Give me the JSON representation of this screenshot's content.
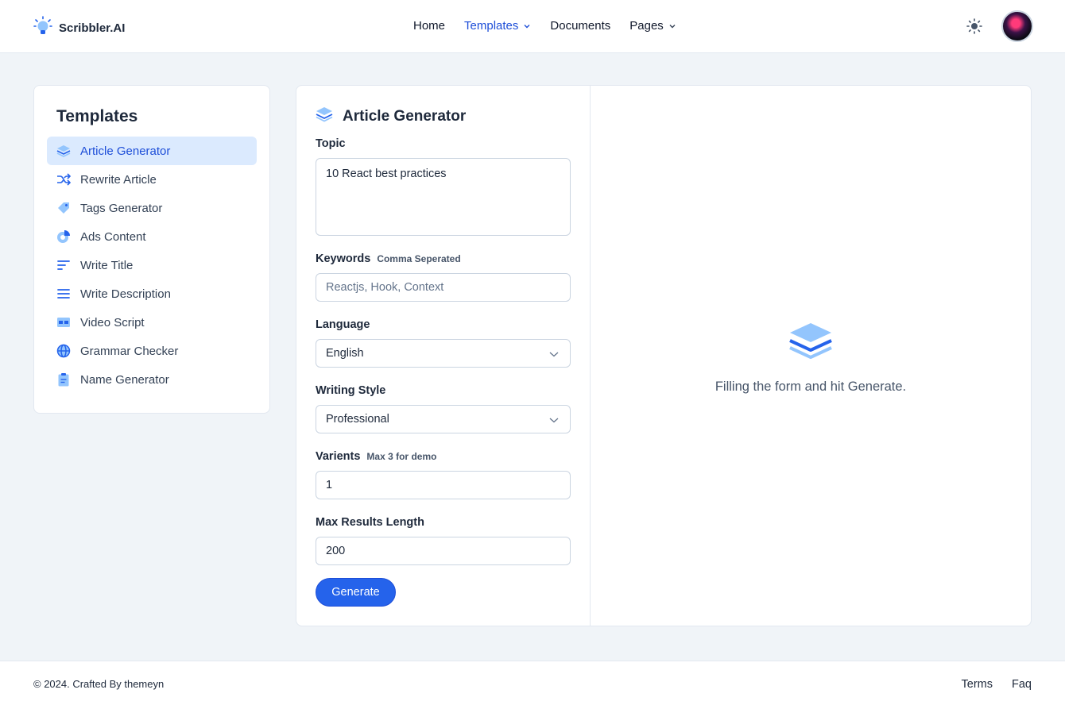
{
  "header": {
    "brand": "Scribbler.AI",
    "nav": [
      {
        "label": "Home"
      },
      {
        "label": "Templates"
      },
      {
        "label": "Documents"
      },
      {
        "label": "Pages"
      }
    ]
  },
  "sidebar": {
    "title": "Templates",
    "items": [
      {
        "label": "Article Generator",
        "icon": "layers-icon"
      },
      {
        "label": "Rewrite Article",
        "icon": "shuffle-icon"
      },
      {
        "label": "Tags Generator",
        "icon": "tag-icon"
      },
      {
        "label": "Ads Content",
        "icon": "pie-chart-icon"
      },
      {
        "label": "Write Title",
        "icon": "align-left-icon"
      },
      {
        "label": "Write Description",
        "icon": "menu-lines-icon"
      },
      {
        "label": "Video Script",
        "icon": "film-icon"
      },
      {
        "label": "Grammar Checker",
        "icon": "globe-icon"
      },
      {
        "label": "Name Generator",
        "icon": "clipboard-icon"
      }
    ]
  },
  "form": {
    "title": "Article Generator",
    "topic_label": "Topic",
    "topic_value": "10 React best practices",
    "keywords_label": "Keywords",
    "keywords_hint": "Comma Seperated",
    "keywords_placeholder": "Reactjs, Hook, Context",
    "language_label": "Language",
    "language_value": "English",
    "style_label": "Writing Style",
    "style_value": "Professional",
    "variants_label": "Varients",
    "variants_hint": "Max 3 for demo",
    "variants_value": "1",
    "maxlen_label": "Max Results Length",
    "maxlen_value": "200",
    "generate_label": "Generate"
  },
  "result": {
    "empty_text": "Filling the form and hit Generate."
  },
  "footer": {
    "copyright": "© 2024. Crafted By themeyn",
    "links": [
      {
        "label": "Terms"
      },
      {
        "label": "Faq"
      }
    ]
  },
  "colors": {
    "accent": "#2563eb",
    "accent_light": "#dbeafe",
    "background": "#f0f4f8"
  }
}
